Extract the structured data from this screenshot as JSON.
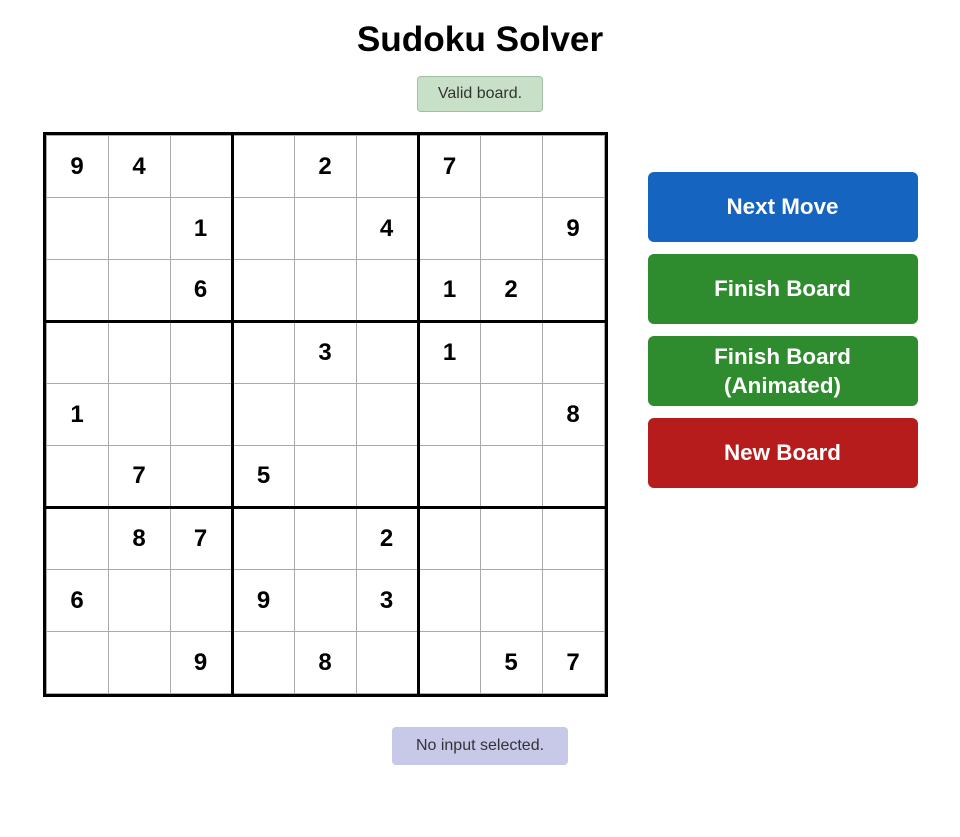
{
  "title": "Sudoku Solver",
  "status": "Valid board.",
  "bottom_status": "No input selected.",
  "buttons": {
    "next_move": "Next Move",
    "finish_board": "Finish Board",
    "finish_board_animated": "Finish Board\n(Animated)",
    "new_board": "New Board"
  },
  "grid": [
    [
      "9",
      "4",
      "",
      "",
      "2",
      "",
      "7",
      "",
      ""
    ],
    [
      "",
      "",
      "1",
      "",
      "",
      "4",
      "",
      "",
      "9"
    ],
    [
      "",
      "",
      "6",
      "",
      "",
      "",
      "1",
      "2",
      ""
    ],
    [
      "",
      "",
      "",
      "",
      "3",
      "",
      "1",
      "",
      ""
    ],
    [
      "1",
      "",
      "",
      "",
      "",
      "",
      "",
      "",
      "8"
    ],
    [
      "",
      "7",
      "",
      "5",
      "",
      "",
      "",
      "",
      ""
    ],
    [
      "",
      "8",
      "7",
      "",
      "",
      "2",
      "",
      "",
      ""
    ],
    [
      "6",
      "",
      "",
      "9",
      "",
      "3",
      "",
      "",
      ""
    ],
    [
      "",
      "",
      "9",
      "",
      "8",
      "",
      "",
      "5",
      "7"
    ]
  ]
}
